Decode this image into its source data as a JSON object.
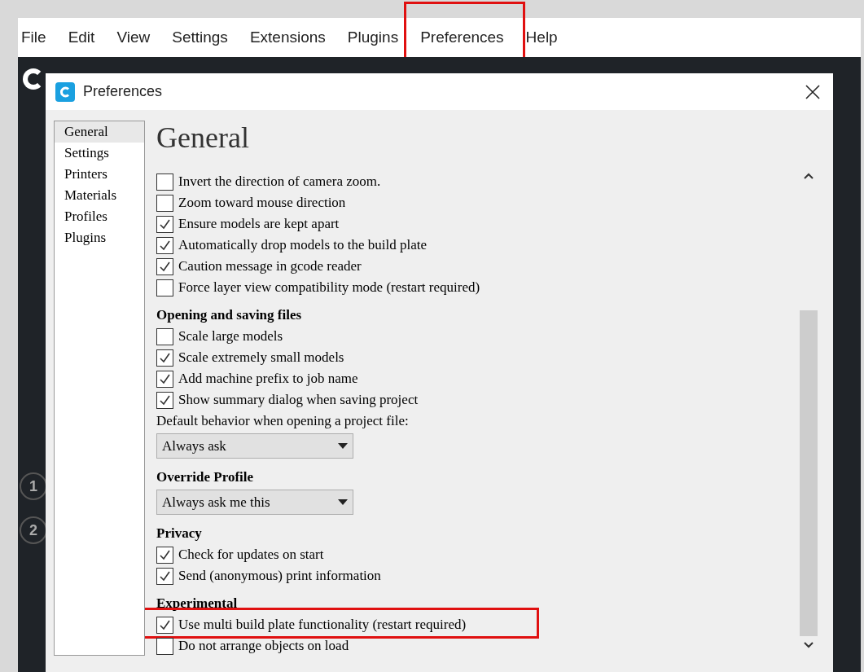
{
  "menu_bar": [
    {
      "label": "File",
      "highlighted": false
    },
    {
      "label": "Edit",
      "highlighted": false
    },
    {
      "label": "View",
      "highlighted": false
    },
    {
      "label": "Settings",
      "highlighted": false
    },
    {
      "label": "Extensions",
      "highlighted": false
    },
    {
      "label": "Plugins",
      "highlighted": false
    },
    {
      "label": "Preferences",
      "highlighted": true
    },
    {
      "label": "Help",
      "highlighted": false
    }
  ],
  "background_steps": [
    "1",
    "2"
  ],
  "dialog": {
    "title": "Preferences",
    "sidebar": [
      {
        "label": "General",
        "selected": true
      },
      {
        "label": "Settings",
        "selected": false
      },
      {
        "label": "Printers",
        "selected": false
      },
      {
        "label": "Materials",
        "selected": false
      },
      {
        "label": "Profiles",
        "selected": false
      },
      {
        "label": "Plugins",
        "selected": false
      }
    ],
    "heading": "General",
    "blocks": [
      {
        "kind": "checkbox",
        "label": "Invert the direction of camera zoom.",
        "checked": false,
        "highlighted": false
      },
      {
        "kind": "checkbox",
        "label": "Zoom toward mouse direction",
        "checked": false,
        "highlighted": false
      },
      {
        "kind": "checkbox",
        "label": "Ensure models are kept apart",
        "checked": true,
        "highlighted": false
      },
      {
        "kind": "checkbox",
        "label": "Automatically drop models to the build plate",
        "checked": true,
        "highlighted": false
      },
      {
        "kind": "checkbox",
        "label": "Caution message in gcode reader",
        "checked": true,
        "highlighted": false
      },
      {
        "kind": "checkbox",
        "label": "Force layer view compatibility mode (restart required)",
        "checked": false,
        "highlighted": false
      },
      {
        "kind": "section",
        "label": "Opening and saving files"
      },
      {
        "kind": "checkbox",
        "label": "Scale large models",
        "checked": false,
        "highlighted": false
      },
      {
        "kind": "checkbox",
        "label": "Scale extremely small models",
        "checked": true,
        "highlighted": false
      },
      {
        "kind": "checkbox",
        "label": "Add machine prefix to job name",
        "checked": true,
        "highlighted": false
      },
      {
        "kind": "checkbox",
        "label": "Show summary dialog when saving project",
        "checked": true,
        "highlighted": false
      },
      {
        "kind": "label",
        "label": "Default behavior when opening a project file:"
      },
      {
        "kind": "dropdown",
        "label": "Always ask"
      },
      {
        "kind": "section",
        "label": "Override Profile"
      },
      {
        "kind": "dropdown",
        "label": "Always ask me this"
      },
      {
        "kind": "section",
        "label": "Privacy"
      },
      {
        "kind": "checkbox",
        "label": "Check for updates on start",
        "checked": true,
        "highlighted": false
      },
      {
        "kind": "checkbox",
        "label": "Send (anonymous) print information",
        "checked": true,
        "highlighted": false
      },
      {
        "kind": "section",
        "label": "Experimental"
      },
      {
        "kind": "checkbox",
        "label": "Use multi build plate functionality (restart required)",
        "checked": true,
        "highlighted": true
      },
      {
        "kind": "checkbox",
        "label": "Do not arrange objects on load",
        "checked": false,
        "highlighted": false
      }
    ]
  }
}
